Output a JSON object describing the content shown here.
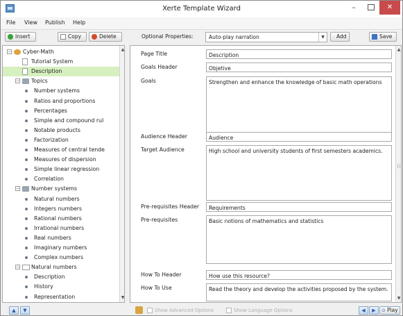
{
  "window": {
    "title": "Xerte Template Wizard",
    "icons": {
      "app": "app-icon",
      "minimize": "minimize-icon",
      "maximize": "maximize-icon",
      "close": "close-icon"
    }
  },
  "menu": [
    "File",
    "View",
    "Publish",
    "Help"
  ],
  "toolbar": {
    "insert": "Insert",
    "copy": "Copy",
    "delete": "Delete",
    "optional_label": "Optional Properties:",
    "optional_selected": "Auto-play narration",
    "add": "Add",
    "save": "Save"
  },
  "tree": [
    {
      "label": "Cyber-Math",
      "level": 0,
      "type": "root",
      "expanded": true
    },
    {
      "label": "Tutorial System",
      "level": 1,
      "type": "page"
    },
    {
      "label": "Description",
      "level": 1,
      "type": "page",
      "selected": true
    },
    {
      "label": "Topics",
      "level": 1,
      "type": "folder",
      "expanded": true
    },
    {
      "label": "Number systems",
      "level": 2,
      "type": "leaf"
    },
    {
      "label": "Ratios and proportions",
      "level": 2,
      "type": "leaf"
    },
    {
      "label": "Percentages",
      "level": 2,
      "type": "leaf"
    },
    {
      "label": "Simple and compound rul",
      "level": 2,
      "type": "leaf"
    },
    {
      "label": "Notable products",
      "level": 2,
      "type": "leaf"
    },
    {
      "label": "Factorization",
      "level": 2,
      "type": "leaf"
    },
    {
      "label": "Measures of central tende",
      "level": 2,
      "type": "leaf"
    },
    {
      "label": "Measures of dispersion",
      "level": 2,
      "type": "leaf"
    },
    {
      "label": "Simple linear regression",
      "level": 2,
      "type": "leaf"
    },
    {
      "label": "Correlation",
      "level": 2,
      "type": "leaf"
    },
    {
      "label": "Number systems",
      "level": 1,
      "type": "folder",
      "expanded": true
    },
    {
      "label": "Natural numbers",
      "level": 2,
      "type": "leaf"
    },
    {
      "label": "Integers numbers",
      "level": 2,
      "type": "leaf"
    },
    {
      "label": "Rational numbers",
      "level": 2,
      "type": "leaf"
    },
    {
      "label": "Irrational numbers",
      "level": 2,
      "type": "leaf"
    },
    {
      "label": "Real numbers",
      "level": 2,
      "type": "leaf"
    },
    {
      "label": "Imaginary numbers",
      "level": 2,
      "type": "leaf"
    },
    {
      "label": "Complex numbers",
      "level": 2,
      "type": "leaf"
    },
    {
      "label": "Natural numbers",
      "level": 1,
      "type": "list",
      "expanded": true
    },
    {
      "label": "Description",
      "level": 2,
      "type": "leaf"
    },
    {
      "label": "History",
      "level": 2,
      "type": "leaf"
    },
    {
      "label": "Representation",
      "level": 2,
      "type": "leaf"
    }
  ],
  "properties": [
    {
      "label": "Page Title",
      "value": "Description"
    },
    {
      "label": "Goals Header",
      "value": "Objetive"
    },
    {
      "label": "Goals",
      "value": "Strengthen and enhance the knowledge of basic math operations"
    },
    {
      "label": "Audience Header",
      "value": "Audience"
    },
    {
      "label": "Target Audience",
      "value": "High school and university students of first semesters academics."
    },
    {
      "label": "Pre-requisites Header",
      "value": "Requirements"
    },
    {
      "label": "Pre-requisites",
      "value": "Basic notions of mathematics and statistics"
    },
    {
      "label": "How To Header",
      "value": "How use this resource?"
    },
    {
      "label": "How To Use",
      "value": "Read the theory and develop the activities proposed by the system."
    }
  ],
  "bottom": {
    "show_advanced": "Show Advanced Options",
    "show_language": "Show Language Options",
    "play": "Play"
  }
}
